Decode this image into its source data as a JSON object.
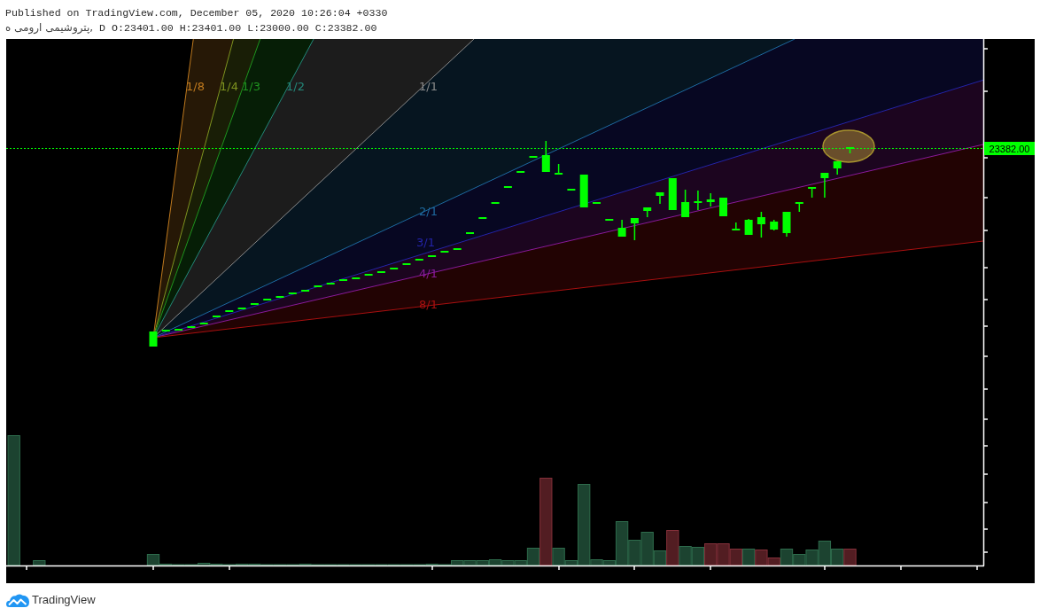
{
  "header": {
    "title": "Published on TradingView.com, December 05, 2020 10:26:04 +0330",
    "symbol": "پتروشیمی ارومی ه,",
    "interval": "D",
    "ohlc": [
      "O:23401.00",
      "H:23401.00",
      "L:23000.00",
      "C:23382.00"
    ]
  },
  "chart": {
    "gann_fan": {
      "levels": [
        {
          "label": "1/8",
          "color": "#c07a1e"
        },
        {
          "label": "1/4",
          "color": "#7f9420"
        },
        {
          "label": "1/3",
          "color": "#1f951f"
        },
        {
          "label": "1/2",
          "color": "#23887a"
        },
        {
          "label": "1/1",
          "color": "#8a8a8a"
        },
        {
          "label": "2/1",
          "color": "#1e6aa0"
        },
        {
          "label": "3/1",
          "color": "#2424a8"
        },
        {
          "label": "4/1",
          "color": "#8a1a9a"
        },
        {
          "label": "8/1",
          "color": "#a81010"
        }
      ]
    },
    "last_price": "23382.00"
  },
  "footer": {
    "brand": "TradingView"
  }
}
